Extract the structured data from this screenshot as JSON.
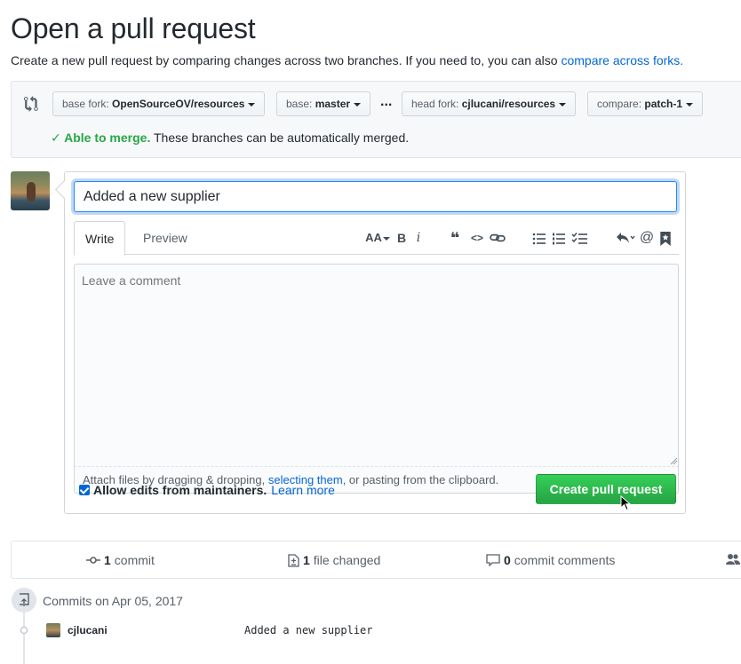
{
  "header": {
    "title": "Open a pull request",
    "subtitle_text": "Create a new pull request by comparing changes across two branches. If you need to, you can also ",
    "subtitle_link": "compare across forks."
  },
  "range": {
    "base_fork": {
      "label": "base fork:",
      "value": "OpenSourceOV/resources"
    },
    "base": {
      "label": "base:",
      "value": "master"
    },
    "ellipsis": "...",
    "head_fork": {
      "label": "head fork:",
      "value": "cjlucani/resources"
    },
    "compare": {
      "label": "compare:",
      "value": "patch-1"
    },
    "merge_ok": "✓ Able to merge.",
    "merge_text": " These branches can be automatically merged."
  },
  "form": {
    "title_value": "Added a new supplier",
    "tabs": [
      {
        "label": "Write"
      },
      {
        "label": "Preview"
      }
    ],
    "comment_placeholder": "Leave a comment",
    "attach_prefix": "Attach files by dragging & dropping, ",
    "attach_link": "selecting them",
    "attach_suffix": ", or pasting from the clipboard.",
    "allow_edits_label": "Allow edits from maintainers.",
    "learn_more": "Learn more",
    "create_button": "Create pull request"
  },
  "toolbar": {
    "header_icon": "AA",
    "bold_icon": "B",
    "italic_icon": "i",
    "quote_icon": "❝",
    "code_icon": "<>",
    "mention_icon": "@"
  },
  "stats": {
    "commits_count": "1",
    "commits_label": "commit",
    "files_count": "1",
    "files_label": "file changed",
    "comments_count": "0",
    "comments_label": "commit comments"
  },
  "commits": {
    "header": "Commits on Apr 05, 2017",
    "items": [
      {
        "author": "cjlucani",
        "message": "Added a new supplier"
      }
    ]
  },
  "colors": {
    "accent": "#0366d6",
    "success": "#28a745",
    "button_green": "#2ea44f"
  }
}
